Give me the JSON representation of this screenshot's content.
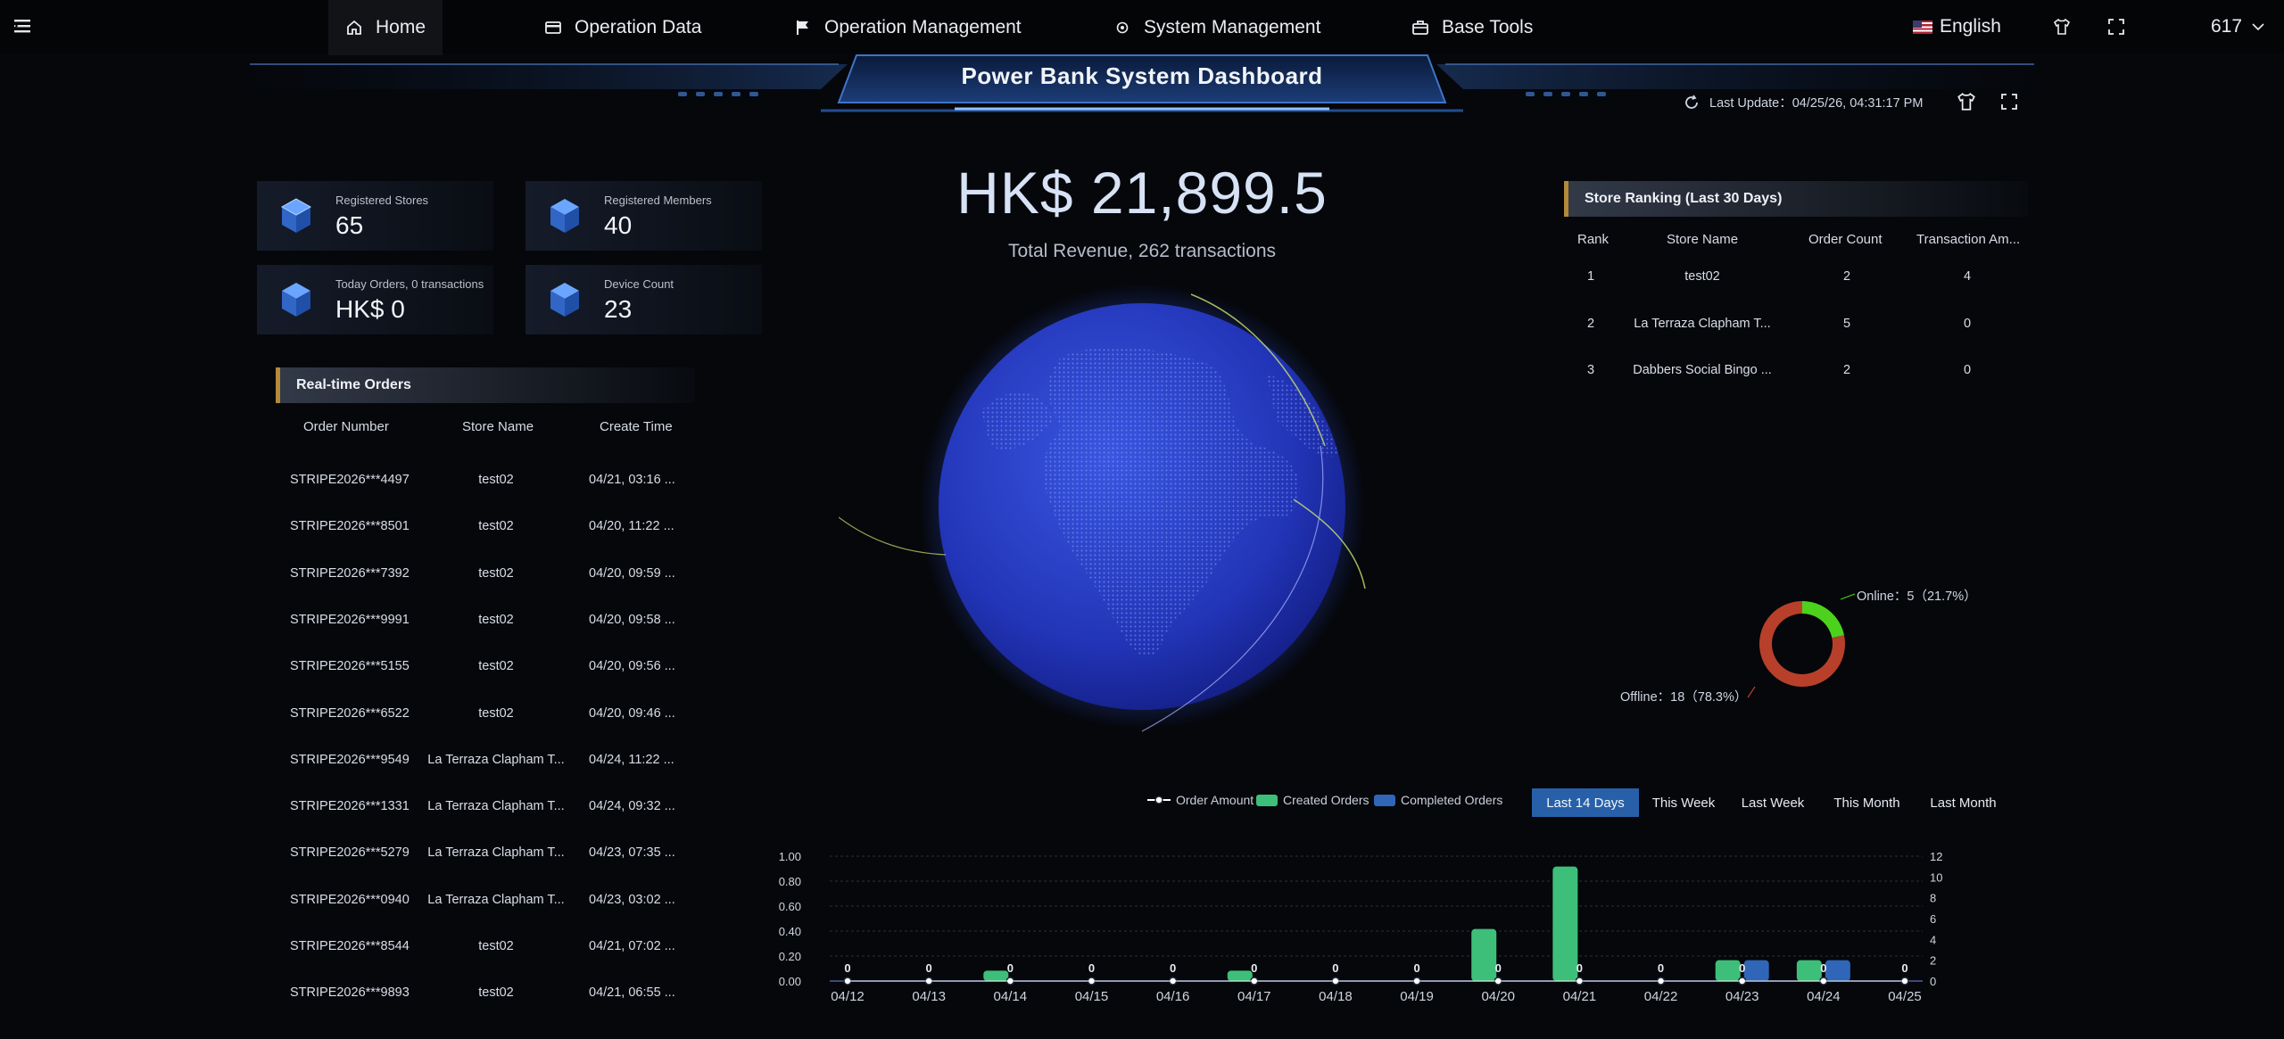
{
  "nav": {
    "items": [
      {
        "label": "Home",
        "icon": "home-icon"
      },
      {
        "label": "Operation Data",
        "icon": "card-icon"
      },
      {
        "label": "Operation Management",
        "icon": "flag-icon"
      },
      {
        "label": "System Management",
        "icon": "gear-icon"
      },
      {
        "label": "Base Tools",
        "icon": "toolbox-icon"
      }
    ],
    "language": "English",
    "user": "617"
  },
  "dashboard": {
    "title": "Power Bank System Dashboard",
    "last_update": "Last Update：04/25/26, 04:31:17 PM"
  },
  "stats": [
    {
      "label": "Registered Stores",
      "value": "65"
    },
    {
      "label": "Registered Members",
      "value": "40"
    },
    {
      "label": "Today Orders, 0 transactions",
      "value": "HK$ 0"
    },
    {
      "label": "Device Count",
      "value": "23"
    }
  ],
  "realtime_orders": {
    "title": "Real-time Orders",
    "columns": [
      "Order Number",
      "Store Name",
      "Create Time"
    ],
    "rows": [
      [
        "STRIPE2026***4497",
        "test02",
        "04/21, 03:16 ..."
      ],
      [
        "STRIPE2026***8501",
        "test02",
        "04/20, 11:22 ..."
      ],
      [
        "STRIPE2026***7392",
        "test02",
        "04/20, 09:59 ..."
      ],
      [
        "STRIPE2026***9991",
        "test02",
        "04/20, 09:58 ..."
      ],
      [
        "STRIPE2026***5155",
        "test02",
        "04/20, 09:56 ..."
      ],
      [
        "STRIPE2026***6522",
        "test02",
        "04/20, 09:46 ..."
      ],
      [
        "STRIPE2026***9549",
        "La Terraza Clapham T...",
        "04/24, 11:22 ..."
      ],
      [
        "STRIPE2026***1331",
        "La Terraza Clapham T...",
        "04/24, 09:32 ..."
      ],
      [
        "STRIPE2026***5279",
        "La Terraza Clapham T...",
        "04/23, 07:35 ..."
      ],
      [
        "STRIPE2026***0940",
        "La Terraza Clapham T...",
        "04/23, 03:02 ..."
      ],
      [
        "STRIPE2026***8544",
        "test02",
        "04/21, 07:02 ..."
      ],
      [
        "STRIPE2026***9893",
        "test02",
        "04/21, 06:55 ..."
      ]
    ]
  },
  "revenue": {
    "value": "HK$ 21,899.5",
    "subtitle": "Total Revenue, 262 transactions"
  },
  "store_ranking": {
    "title": "Store Ranking (Last 30 Days)",
    "columns": [
      "Rank",
      "Store Name",
      "Order Count",
      "Transaction Am..."
    ],
    "rows": [
      [
        "1",
        "test02",
        "2",
        "4"
      ],
      [
        "2",
        "La Terraza Clapham T...",
        "5",
        "0"
      ],
      [
        "3",
        "Dabbers Social Bingo ...",
        "2",
        "0"
      ]
    ]
  },
  "device_status": {
    "online_label": "Online：5（21.7%）",
    "offline_label": "Offline：18（78.3%）",
    "online": 5,
    "offline": 18,
    "colors": {
      "online": "#4cd21c",
      "offline": "#b8402a"
    }
  },
  "time_tabs": [
    "Last 14 Days",
    "This Week",
    "Last Week",
    "This Month",
    "Last Month"
  ],
  "active_tab": "Last 14 Days",
  "chart_data": {
    "type": "bar",
    "categories": [
      "04/12",
      "04/13",
      "04/14",
      "04/15",
      "04/16",
      "04/17",
      "04/18",
      "04/19",
      "04/20",
      "04/21",
      "04/22",
      "04/23",
      "04/24",
      "04/25"
    ],
    "series": [
      {
        "name": "Order Amount",
        "type": "line",
        "axis": "left",
        "values": [
          0,
          0,
          0,
          0,
          0,
          0,
          0,
          0,
          0,
          0,
          0,
          0,
          0,
          0
        ],
        "color": "#ffffff"
      },
      {
        "name": "Created Orders",
        "type": "bar",
        "axis": "right",
        "values": [
          0,
          0,
          1,
          0,
          0,
          1,
          0,
          0,
          5,
          11,
          0,
          2,
          2,
          0
        ],
        "color": "#3dbf7a"
      },
      {
        "name": "Completed Orders",
        "type": "bar",
        "axis": "right",
        "values": [
          0,
          0,
          0,
          0,
          0,
          0,
          0,
          0,
          0,
          0,
          0,
          2,
          2,
          0
        ],
        "color": "#2f66b8"
      }
    ],
    "yleft_ticks": [
      "1.00",
      "0.80",
      "0.60",
      "0.40",
      "0.20",
      "0.00"
    ],
    "yright_ticks": [
      "12",
      "10",
      "8",
      "6",
      "4",
      "2",
      "0"
    ],
    "yleft_lim": [
      0,
      1
    ],
    "yright_lim": [
      0,
      12
    ],
    "data_labels": [
      "0",
      "0",
      "0",
      "0",
      "0",
      "0",
      "0",
      "0",
      "0",
      "0",
      "0",
      "0",
      "0",
      "0"
    ]
  }
}
